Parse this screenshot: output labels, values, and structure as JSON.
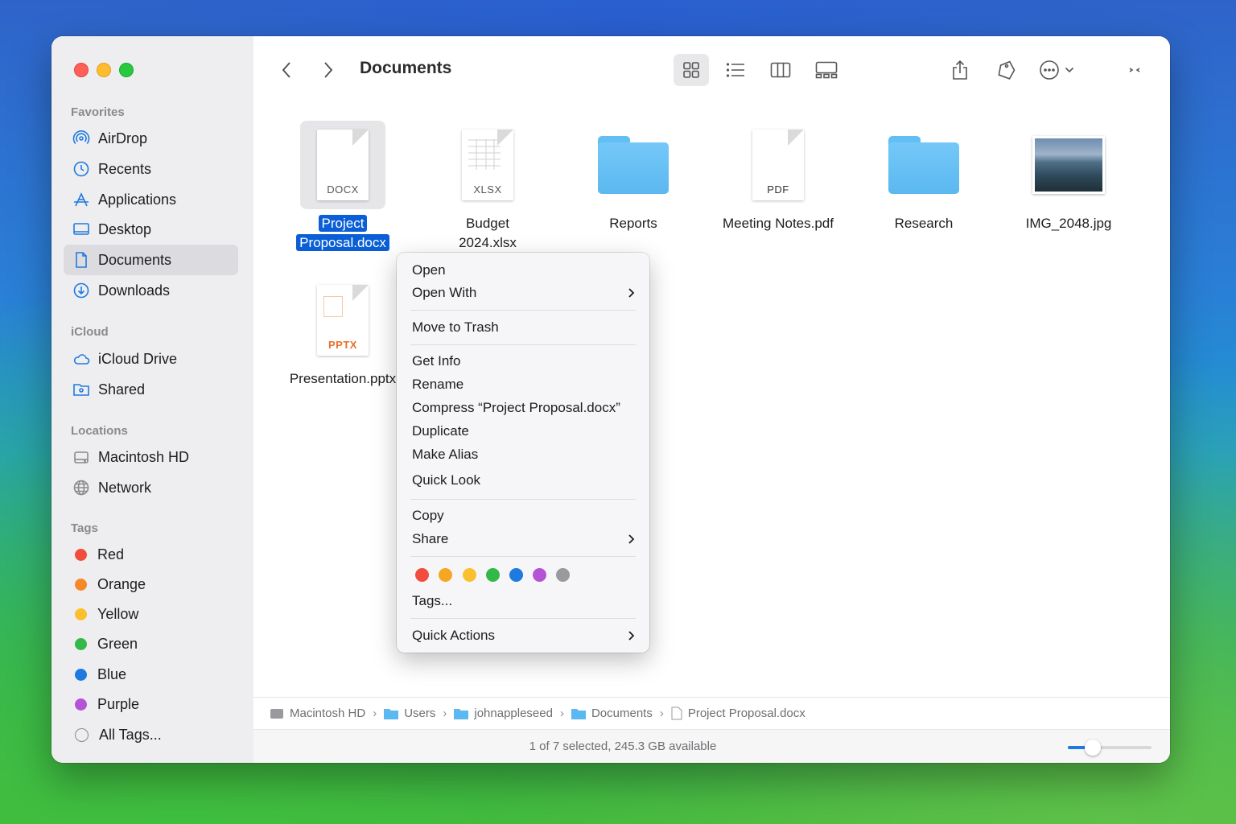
{
  "window": {
    "title": "Documents"
  },
  "sidebar": {
    "favorites_header": "Favorites",
    "favorites": [
      {
        "label": "AirDrop",
        "icon": "airdrop-icon"
      },
      {
        "label": "Recents",
        "icon": "clock-icon"
      },
      {
        "label": "Applications",
        "icon": "applications-icon"
      },
      {
        "label": "Desktop",
        "icon": "desktop-icon"
      },
      {
        "label": "Documents",
        "icon": "document-icon",
        "selected": true
      },
      {
        "label": "Downloads",
        "icon": "download-icon"
      }
    ],
    "icloud_header": "iCloud",
    "icloud": [
      {
        "label": "iCloud Drive",
        "icon": "cloud-icon"
      },
      {
        "label": "Shared",
        "icon": "shared-folder-icon"
      }
    ],
    "locations_header": "Locations",
    "locations": [
      {
        "label": "Macintosh HD",
        "icon": "disk-icon"
      },
      {
        "label": "Network",
        "icon": "globe-icon"
      }
    ],
    "tags_header": "Tags",
    "tags": [
      {
        "label": "Red",
        "color": "#f24c3d"
      },
      {
        "label": "Orange",
        "color": "#f5882a"
      },
      {
        "label": "Yellow",
        "color": "#fbc02d"
      },
      {
        "label": "Green",
        "color": "#33b948"
      },
      {
        "label": "Blue",
        "color": "#1f7ae0"
      },
      {
        "label": "Purple",
        "color": "#b553d6"
      },
      {
        "label": "All Tags...",
        "color": ""
      }
    ]
  },
  "files": [
    {
      "name_line1": "Project",
      "name_line2": "Proposal.docx",
      "ext": "DOCX",
      "kind": "doc",
      "selected": true
    },
    {
      "name_line1": "Budget",
      "name_line2": "2024.xlsx",
      "ext": "XLSX",
      "kind": "doc"
    },
    {
      "name_line1": "Reports",
      "name_line2": "",
      "ext": "",
      "kind": "folder"
    },
    {
      "name_line1": "Meeting Notes.pdf",
      "name_line2": "",
      "ext": "PDF",
      "kind": "doc"
    },
    {
      "name_line1": "Research",
      "name_line2": "",
      "ext": "",
      "kind": "folder"
    },
    {
      "name_line1": "IMG_2048.jpg",
      "name_line2": "",
      "ext": "",
      "kind": "image"
    },
    {
      "name_line1": "Presentation.pptx",
      "name_line2": "",
      "ext": "PPTX",
      "kind": "doc"
    }
  ],
  "context_menu": {
    "open": "Open",
    "open_with": "Open With",
    "move_to_trash": "Move to Trash",
    "get_info": "Get Info",
    "rename": "Rename",
    "compress": "Compress “Project Proposal.docx”",
    "duplicate": "Duplicate",
    "make_alias": "Make Alias",
    "quick_look": "Quick Look",
    "copy": "Copy",
    "share": "Share",
    "tags": "Tags...",
    "quick_actions": "Quick Actions",
    "tag_colors": [
      "#f24c3d",
      "#f5a623",
      "#fbc02d",
      "#33b948",
      "#1f7ae0",
      "#b553d6",
      "#9a9a9e"
    ]
  },
  "pathbar": [
    "Macintosh HD",
    "Users",
    "johnappleseed",
    "Documents",
    "Project Proposal.docx"
  ],
  "status": {
    "text": "1 of 7 selected, 245.3 GB available",
    "icon_size_level": 0.3
  }
}
